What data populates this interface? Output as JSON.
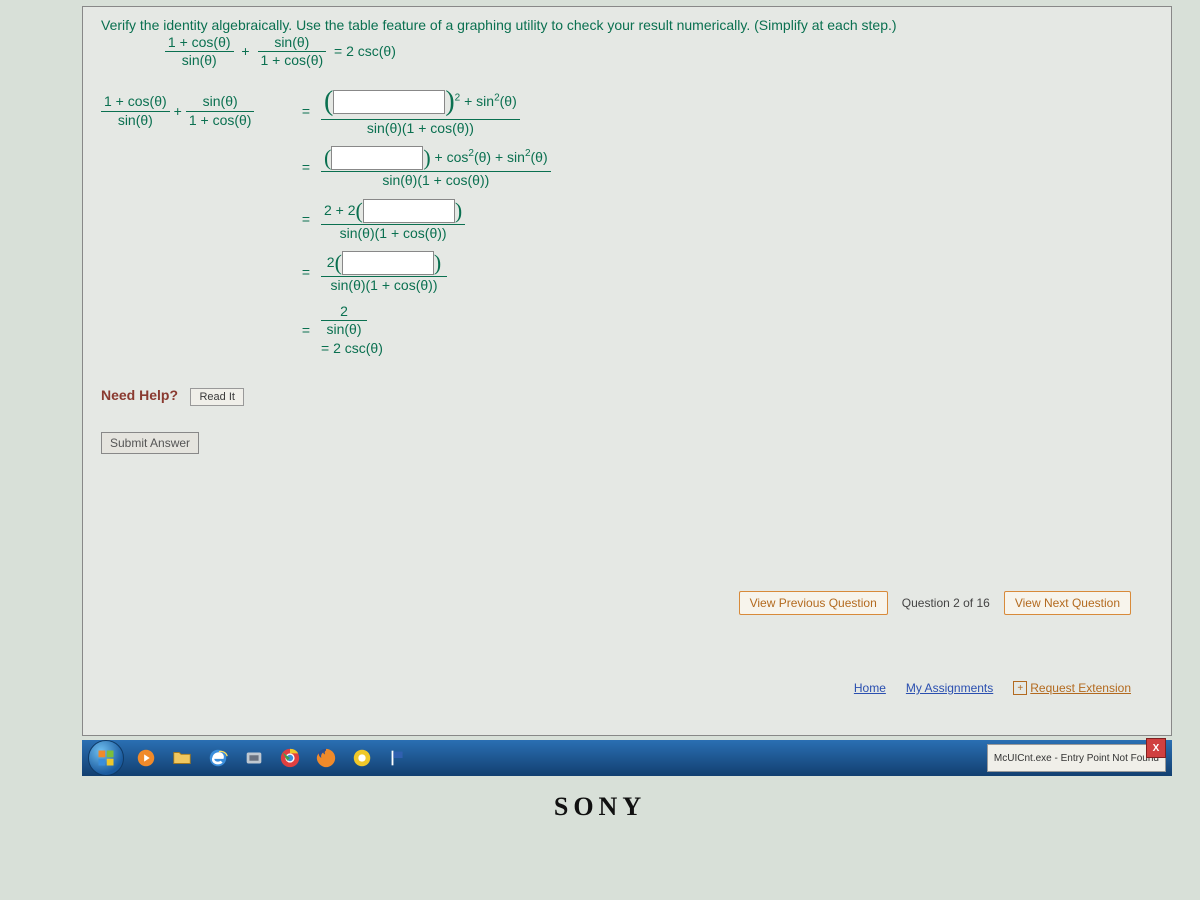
{
  "question": {
    "instruction": "Verify the identity algebraically. Use the table feature of a graphing utility to check your result numerically. (Simplify at each step.)",
    "identity_lhs_term1_num": "1 + cos(θ)",
    "identity_lhs_term1_den": "sin(θ)",
    "identity_lhs_op": "+",
    "identity_lhs_term2_num": "sin(θ)",
    "identity_lhs_term2_den": "1 + cos(θ)",
    "identity_rhs": "= 2 csc(θ)"
  },
  "steps": {
    "step1_lhs_t1_num": "1 + cos(θ)",
    "step1_lhs_t1_den": "sin(θ)",
    "step1_lhs_op": "+",
    "step1_lhs_t2_num": "sin(θ)",
    "step1_lhs_t2_den": "1 + cos(θ)",
    "step1_rhs_num_tail": " + sin",
    "step1_rhs_num_tail_sup": "2",
    "step1_rhs_num_tail2": "(θ)",
    "step1_rhs_den": "sin(θ)(1 + cos(θ))",
    "step2_rhs_num_tail": " + cos",
    "step2_rhs_num_tail_sup": "2",
    "step2_rhs_num_tail_mid": "(θ) + sin",
    "step2_rhs_num_tail_sup2": "2",
    "step2_rhs_num_tail2": "(θ)",
    "step2_rhs_den": "sin(θ)(1 + cos(θ))",
    "step3_pref": "2 + 2",
    "step3_den": "sin(θ)(1 + cos(θ))",
    "step4_pref": "2",
    "step4_den": "sin(θ)(1 + cos(θ))",
    "step5_num": "2",
    "step5_den": "sin(θ)",
    "step5_final": "= 2 csc(θ)"
  },
  "help": {
    "label": "Need Help?",
    "read": "Read It"
  },
  "submit": {
    "label": "Submit Answer"
  },
  "nav": {
    "prev": "View Previous Question",
    "status": "Question 2 of 16",
    "next": "View Next Question"
  },
  "footer": {
    "home": "Home",
    "assignments": "My Assignments",
    "extension": "Request Extension"
  },
  "taskbar": {
    "popup": "McUICnt.exe - Entry Point Not Found"
  },
  "brand": "SONY"
}
